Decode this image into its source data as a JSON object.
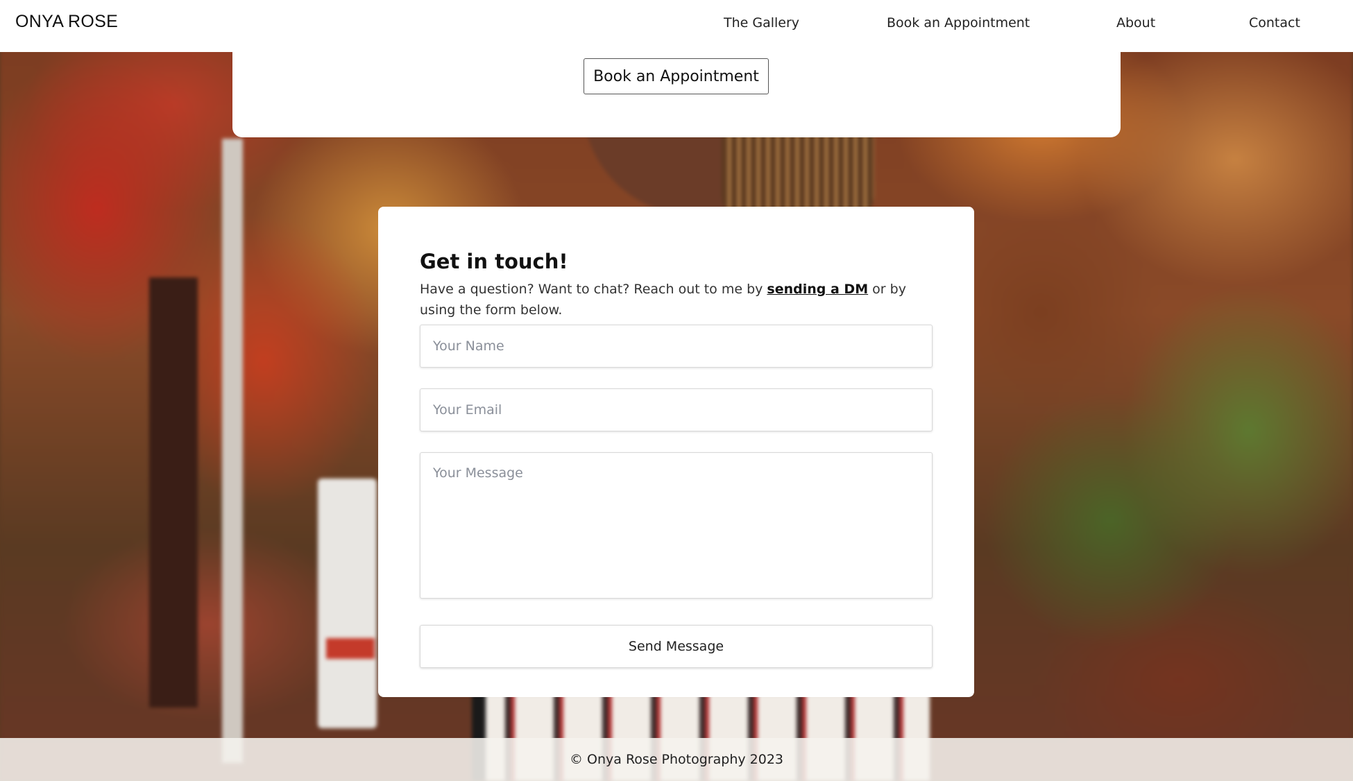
{
  "brand": "ONYA ROSE",
  "nav": {
    "items": [
      {
        "label": "The Gallery"
      },
      {
        "label": "Book an Appointment"
      },
      {
        "label": "About"
      },
      {
        "label": "Contact"
      }
    ]
  },
  "top_card": {
    "button_label": "Book an Appointment"
  },
  "contact": {
    "title": "Get in touch!",
    "intro_before": "Have a question? Want to chat? Reach out to me by ",
    "intro_link": "sending a DM",
    "intro_after": " or by using the form below.",
    "name_placeholder": "Your Name",
    "email_placeholder": "Your Email",
    "message_placeholder": "Your Message",
    "send_label": "Send Message"
  },
  "footer": {
    "text": "© Onya Rose Photography 2023"
  }
}
